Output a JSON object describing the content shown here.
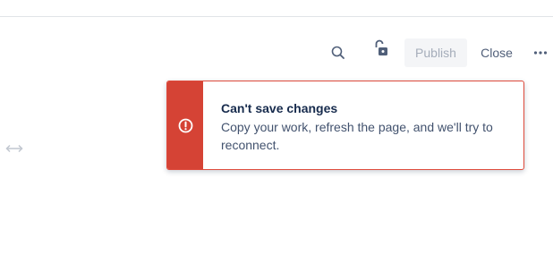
{
  "toolbar": {
    "search_icon": "search-icon",
    "lock_icon": "unlocked-padlock-icon",
    "publish_label": "Publish",
    "close_label": "Close",
    "more_icon": "more-horizontal-icon"
  },
  "resize_handle": {
    "icon": "horizontal-resize-arrows-icon"
  },
  "flag": {
    "type": "error",
    "icon": "error-exclamation-icon",
    "title": "Can't save changes",
    "message": "Copy your work, refresh the page, and we'll try to reconnect.",
    "accent_color": "#d54335"
  },
  "colors": {
    "text_primary": "#172b4d",
    "text_secondary": "#42526e",
    "icon_gray": "#505f79",
    "disabled_text": "#a5adba",
    "disabled_bg": "#f4f5f7",
    "error": "#d54335"
  }
}
